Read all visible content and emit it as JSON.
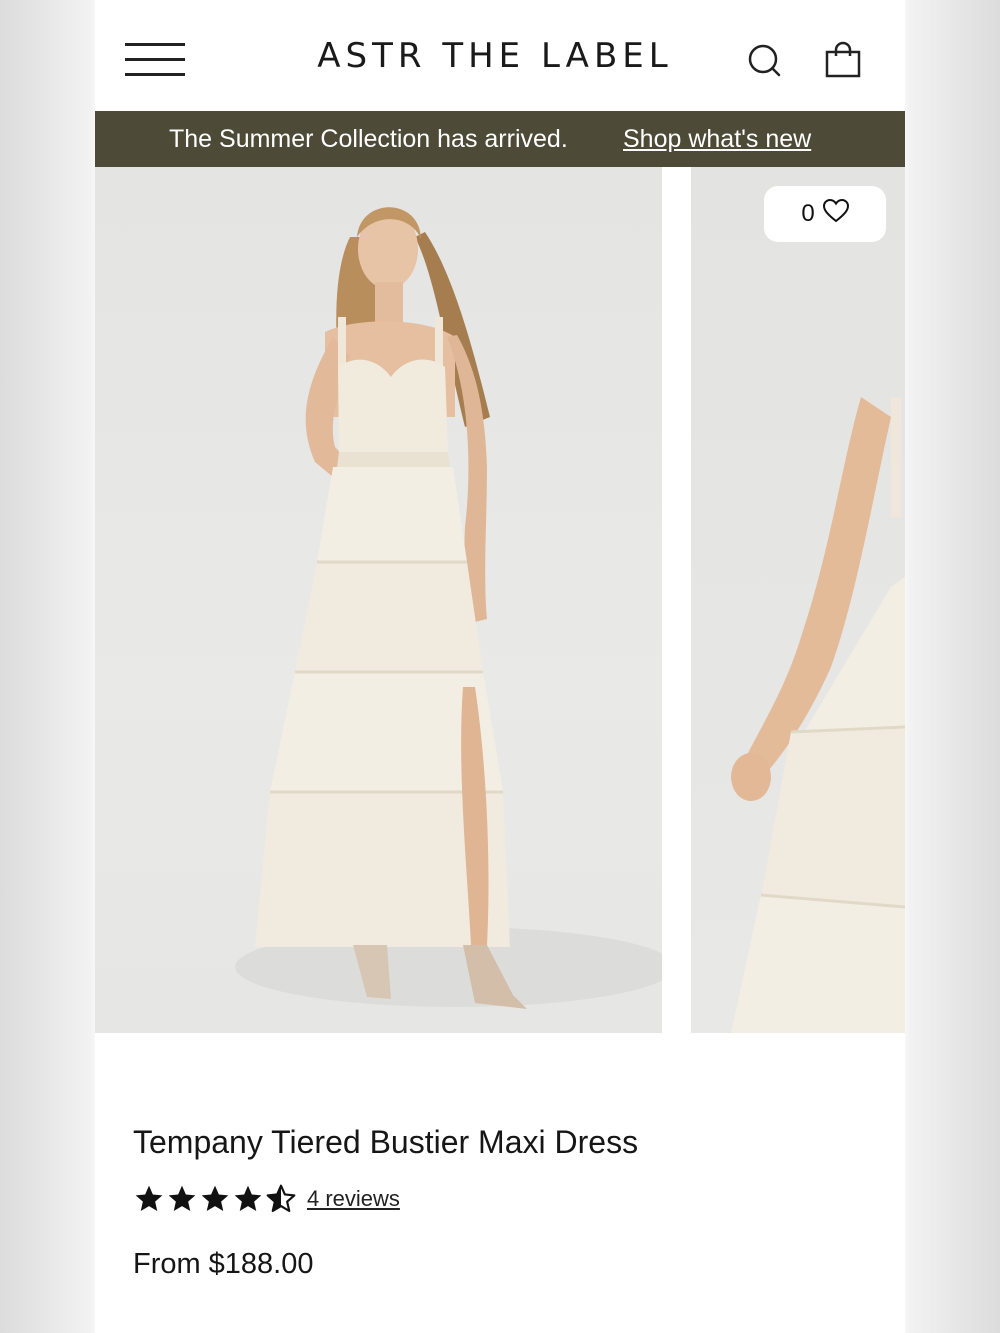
{
  "header": {
    "brand": "ASTR THE LABEL",
    "icons": [
      "hamburger-menu-icon",
      "search-icon",
      "shopping-bag-icon"
    ]
  },
  "announcement": {
    "message": "The Summer Collection has arrived.",
    "link": "Shop what's new"
  },
  "gallery": {
    "wishlist_count": "0"
  },
  "product": {
    "title": "Tempany Tiered Bustier Maxi Dress",
    "rating_stars": 4.5,
    "reviews_label": "4 reviews",
    "price_prefix": "From",
    "price": "$188.00"
  },
  "colors": {
    "announcement_bg": "#4d4a37",
    "text": "#161616",
    "dress": "#f3eee3"
  }
}
